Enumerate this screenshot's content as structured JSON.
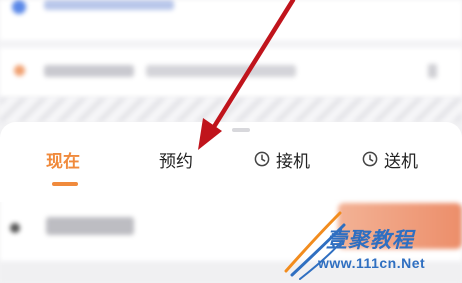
{
  "tabs": [
    {
      "label": "现在",
      "active": true,
      "icon": null
    },
    {
      "label": "预约",
      "active": false,
      "icon": null
    },
    {
      "label": "接机",
      "active": false,
      "icon": "clock-icon"
    },
    {
      "label": "送机",
      "active": false,
      "icon": "clock-icon"
    }
  ],
  "colors": {
    "accent": "#f08a3c",
    "annotation_arrow": "#c0141c",
    "watermark": "#2f6fc1"
  },
  "watermark": {
    "title": "壹聚教程",
    "url": "www.111cn.Net"
  }
}
